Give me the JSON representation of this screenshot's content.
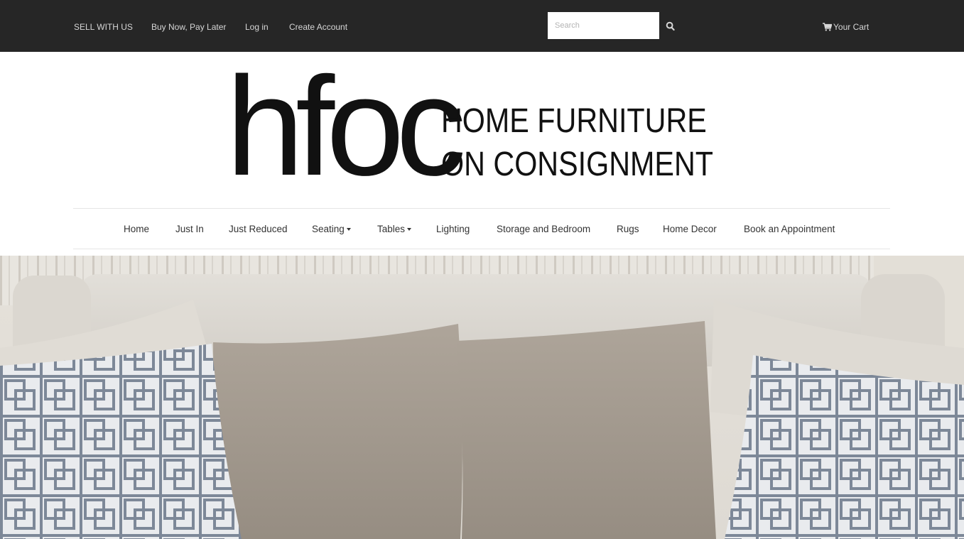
{
  "topbar": {
    "links": [
      {
        "label": "SELL WITH US"
      },
      {
        "label": "Buy Now, Pay Later"
      },
      {
        "label": "Log in"
      },
      {
        "label": "Create Account"
      }
    ],
    "search": {
      "placeholder": "Search",
      "icon": "search-icon"
    },
    "cart": {
      "label": "Your Cart",
      "icon": "shopping-cart-icon"
    }
  },
  "logo": {
    "mark": "hfoc",
    "line1": "HOME FURNITURE",
    "line2": "ON CONSIGNMENT"
  },
  "nav": {
    "items": [
      {
        "label": "Home"
      },
      {
        "label": "Just In"
      },
      {
        "label": "Just Reduced"
      },
      {
        "label": "Seating",
        "dropdown": true
      },
      {
        "label": "Tables",
        "dropdown": true
      },
      {
        "label": "Lighting"
      },
      {
        "label": "Storage and Bedroom"
      },
      {
        "label": "Rugs"
      },
      {
        "label": "Home Decor"
      },
      {
        "label": "Book an Appointment"
      }
    ]
  },
  "hero": {
    "subject": "hero-photo-sofa-with-pillows",
    "colors": {
      "sofa": "#dcd8d1",
      "pillow_taupe": "#a59c91",
      "pillow_pattern": "#7f8b9c"
    }
  }
}
